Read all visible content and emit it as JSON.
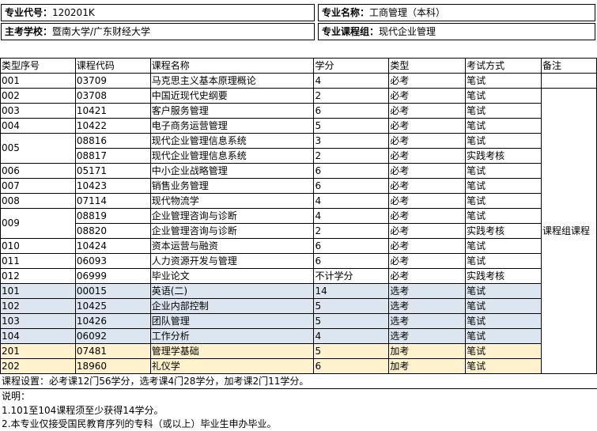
{
  "header": {
    "major_code_label": "专业代号：",
    "major_code": "120201K",
    "major_name_label": "专业名称：",
    "major_name": "工商管理（本科）",
    "school_label": "主考学校：",
    "school": "暨南大学/广东财经大学",
    "group_label": "专业课程组：",
    "group": "现代企业管理"
  },
  "table": {
    "columns": [
      "类型序号",
      "课程代码",
      "课程名称",
      "学分",
      "类型",
      "考试方式",
      "备注"
    ],
    "rows": [
      {
        "seq": "001",
        "code": "03709",
        "name": "马克思主义基本原理概论",
        "credit": "4",
        "type": "必考",
        "exam": "笔试"
      },
      {
        "seq": "002",
        "code": "03708",
        "name": "中国近现代史纲要",
        "credit": "2",
        "type": "必考",
        "exam": "笔试"
      },
      {
        "seq": "003",
        "code": "10421",
        "name": "客户服务管理",
        "credit": "6",
        "type": "必考",
        "exam": "笔试"
      },
      {
        "seq": "004",
        "code": "10422",
        "name": "电子商务运营管理",
        "credit": "5",
        "type": "必考",
        "exam": "笔试"
      },
      {
        "seq": "005",
        "code": "08816",
        "name": "现代企业管理信息系统",
        "credit": "3",
        "type": "必考",
        "exam": "笔试"
      },
      {
        "seq": "",
        "code": "08817",
        "name": "现代企业管理信息系统",
        "credit": "2",
        "type": "必考",
        "exam": "实践考核"
      },
      {
        "seq": "006",
        "code": "05171",
        "name": "中小企业战略管理",
        "credit": "6",
        "type": "必考",
        "exam": "笔试"
      },
      {
        "seq": "007",
        "code": "10423",
        "name": "销售业务管理",
        "credit": "6",
        "type": "必考",
        "exam": "笔试"
      },
      {
        "seq": "008",
        "code": "07114",
        "name": "现代物流学",
        "credit": "4",
        "type": "必考",
        "exam": "笔试"
      },
      {
        "seq": "009",
        "code": "08819",
        "name": "企业管理咨询与诊断",
        "credit": "4",
        "type": "必考",
        "exam": "笔试"
      },
      {
        "seq": "",
        "code": "08820",
        "name": "企业管理咨询与诊断",
        "credit": "2",
        "type": "必考",
        "exam": "实践考核"
      },
      {
        "seq": "010",
        "code": "10424",
        "name": "资本运营与融资",
        "credit": "6",
        "type": "必考",
        "exam": "笔试"
      },
      {
        "seq": "011",
        "code": "06093",
        "name": "人力资源开发与管理",
        "credit": "6",
        "type": "必考",
        "exam": "笔试"
      },
      {
        "seq": "012",
        "code": "06999",
        "name": "毕业论文",
        "credit": "不计学分",
        "type": "必考",
        "exam": "实践考核"
      },
      {
        "seq": "101",
        "code": "00015",
        "name": "英语(二)",
        "credit": "14",
        "type": "选考",
        "exam": "笔试"
      },
      {
        "seq": "102",
        "code": "10425",
        "name": "企业内部控制",
        "credit": "5",
        "type": "选考",
        "exam": "笔试"
      },
      {
        "seq": "103",
        "code": "10426",
        "name": "团队管理",
        "credit": "5",
        "type": "选考",
        "exam": "笔试"
      },
      {
        "seq": "104",
        "code": "06092",
        "name": "工作分析",
        "credit": "4",
        "type": "选考",
        "exam": "笔试"
      },
      {
        "seq": "201",
        "code": "07481",
        "name": "管理学基础",
        "credit": "5",
        "type": "加考",
        "exam": "笔试"
      },
      {
        "seq": "202",
        "code": "18960",
        "name": "礼仪学",
        "credit": "6",
        "type": "加考",
        "exam": "笔试"
      }
    ],
    "remark": "课程组课程"
  },
  "notes": {
    "settings": "课程设置：必考课12门56学分，选考课4门28学分，加考课2门11学分。",
    "explain_title": "说明：",
    "line1": "1.101至104课程须至少获得14学分。",
    "line2": "2.本专业仅接受国民教育序列的专科（或以上）毕业生申办毕业。"
  }
}
